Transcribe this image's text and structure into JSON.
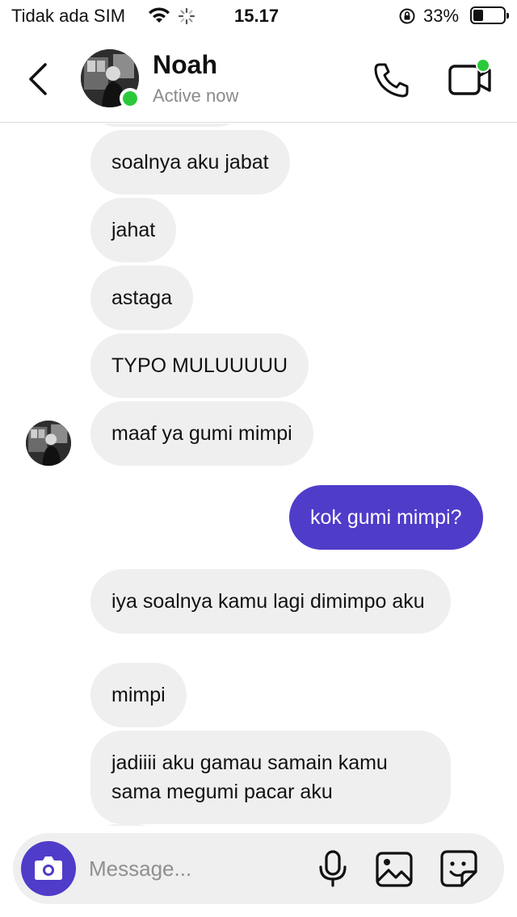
{
  "status_bar": {
    "carrier": "Tidak ada SIM",
    "time": "15.17",
    "battery": "33%",
    "battery_level": 0.33,
    "icons": [
      "wifi-icon",
      "activity-spinner-icon",
      "orientation-lock-icon",
      "battery-icon"
    ]
  },
  "header": {
    "contact_name": "Noah",
    "contact_status": "Active now",
    "online": true,
    "icons": [
      "back-chevron-icon",
      "phone-icon",
      "video-camera-icon"
    ]
  },
  "messages": [
    {
      "direction": "received",
      "text": "soalnya aku jabat"
    },
    {
      "direction": "received",
      "text": "jahat"
    },
    {
      "direction": "received",
      "text": "astaga"
    },
    {
      "direction": "received",
      "text": "TYPO MULUUUUU"
    },
    {
      "direction": "received",
      "text": "maaf ya gumi mimpi"
    },
    {
      "direction": "sent",
      "text": "kok gumi mimpi?"
    },
    {
      "direction": "received",
      "text": "iya soalnya kamu lagi dimimpo aku"
    },
    {
      "direction": "received",
      "text": "mimpi"
    },
    {
      "direction": "received",
      "text": "jadiiii aku gamau samain kamu sama megumi pacar aku"
    }
  ],
  "composer": {
    "placeholder": "Message...",
    "icons": [
      "camera-icon",
      "microphone-icon",
      "image-gallery-icon",
      "sticker-icon"
    ]
  },
  "colors": {
    "accent": "#4f3cc9",
    "received_bubble": "#efefef",
    "online_green": "#2bc93a",
    "secondary_text": "#8a8a8a"
  }
}
